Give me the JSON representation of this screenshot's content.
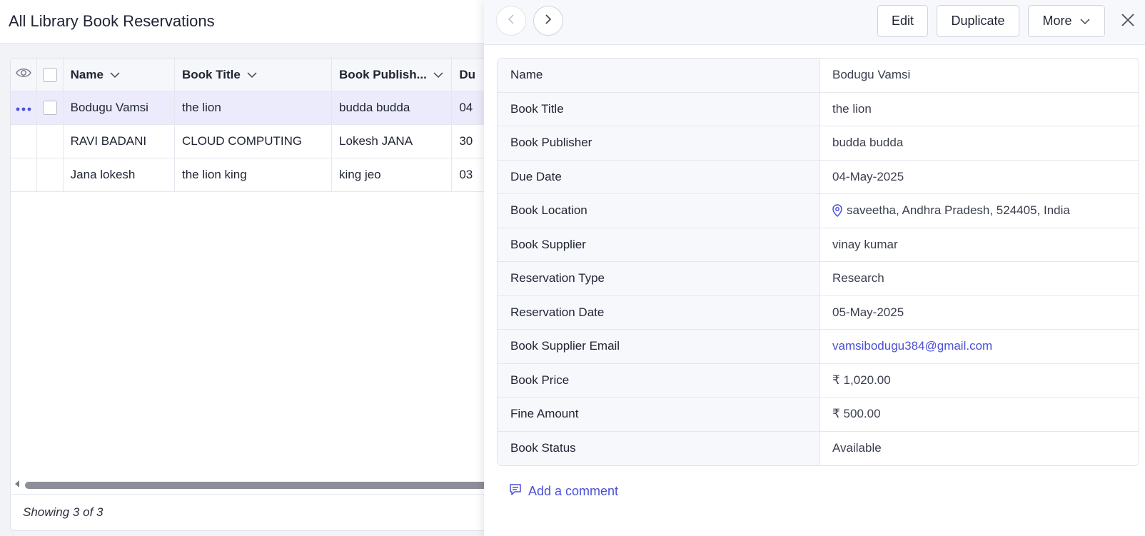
{
  "page": {
    "title": "All Library Book Reservations"
  },
  "grid": {
    "columns": {
      "name": "Name",
      "book_title": "Book Title",
      "book_publisher": "Book Publish...",
      "due": "Du"
    },
    "rows": [
      {
        "name": "Bodugu Vamsi",
        "book_title": "the lion",
        "book_publisher": "budda budda",
        "due": "04"
      },
      {
        "name": "RAVI BADANI",
        "book_title": "CLOUD COMPUTING",
        "book_publisher": "Lokesh JANA",
        "due": "30"
      },
      {
        "name": "Jana lokesh",
        "book_title": "the lion king",
        "book_publisher": "king jeo",
        "due": "03"
      }
    ],
    "footer": "Showing 3 of 3"
  },
  "drawer": {
    "buttons": {
      "edit": "Edit",
      "duplicate": "Duplicate",
      "more": "More"
    },
    "fields": [
      {
        "label": "Name",
        "value": "Bodugu Vamsi"
      },
      {
        "label": "Book Title",
        "value": "the lion"
      },
      {
        "label": "Book Publisher",
        "value": "budda budda"
      },
      {
        "label": "Due Date",
        "value": "04-May-2025"
      },
      {
        "label": "Book Location",
        "value": "saveetha, Andhra Pradesh, 524405, India",
        "icon": "location-pin-icon"
      },
      {
        "label": "Book Supplier",
        "value": "vinay kumar"
      },
      {
        "label": "Reservation Type",
        "value": "Research"
      },
      {
        "label": "Reservation Date",
        "value": "05-May-2025"
      },
      {
        "label": "Book Supplier Email",
        "value": "vamsibodugu384@gmail.com"
      },
      {
        "label": "Book Price",
        "value": "₹ 1,020.00"
      },
      {
        "label": "Fine Amount",
        "value": "₹ 500.00"
      },
      {
        "label": "Book Status",
        "value": "Available"
      }
    ],
    "comment_link": "Add a comment"
  },
  "colors": {
    "accent": "#4b50d6",
    "selected_row": "#ebebfb",
    "label_bg": "#f7f8fc"
  }
}
